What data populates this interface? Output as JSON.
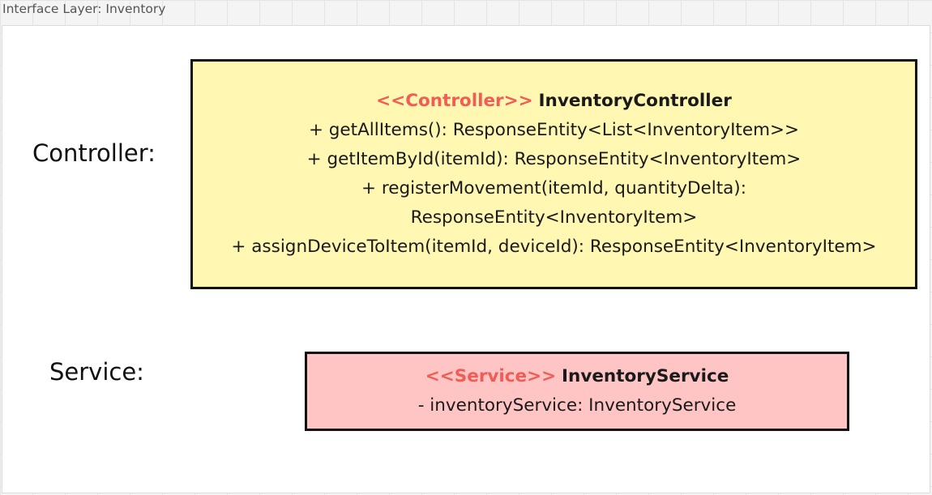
{
  "frame": {
    "title": "Interface Layer: Inventory"
  },
  "labels": {
    "controller": "Controller:",
    "service": "Service:"
  },
  "controller_box": {
    "stereotype": "<<Controller>>",
    "name": "InventoryController",
    "members": [
      "+ getAllItems(): ResponseEntity<List<InventoryItem>>",
      "+ getItemById(itemId): ResponseEntity<InventoryItem>",
      "+ registerMovement(itemId, quantityDelta):",
      "ResponseEntity<InventoryItem>",
      "+ assignDeviceToItem(itemId, deviceId): ResponseEntity<InventoryItem>"
    ]
  },
  "service_box": {
    "stereotype": "<<Service>>",
    "name": "InventoryService",
    "members": [
      "- inventoryService: InventoryService"
    ]
  },
  "colors": {
    "controller_fill": "#fff7b2",
    "service_fill": "#ffc5c5",
    "stereotype_text": "#f25c54",
    "border": "#111111"
  }
}
